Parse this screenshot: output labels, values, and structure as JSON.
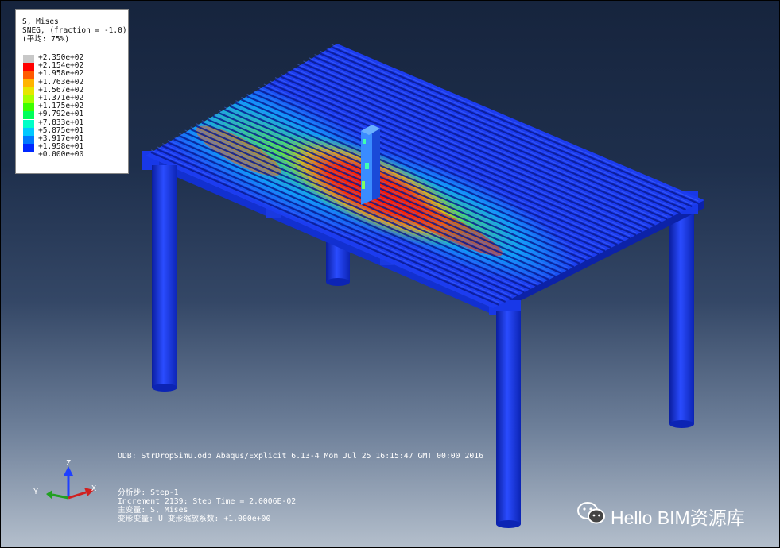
{
  "legend": {
    "title": "S, Mises",
    "subtitle": "SNEG, (fraction = -1.0)",
    "average_label": "(平均: 75%)",
    "colors": [
      "#c8c8c8",
      "#ff0000",
      "#ff5a00",
      "#ffb400",
      "#e6e600",
      "#a6ff00",
      "#3cff00",
      "#00ff5a",
      "#00ffc8",
      "#00c8ff",
      "#0078ff",
      "#0028ff",
      "#0000ff"
    ],
    "values": [
      "+2.350e+02",
      "+2.154e+02",
      "+1.958e+02",
      "+1.763e+02",
      "+1.567e+02",
      "+1.371e+02",
      "+1.175e+02",
      "+9.792e+01",
      "+7.833e+01",
      "+5.875e+01",
      "+3.917e+01",
      "+1.958e+01",
      "+0.000e+00"
    ]
  },
  "info": {
    "odb_line": "ODB: StrDropSimu.odb   Abaqus/Explicit 6.13-4   Mon Jul 25 16:15:47 GMT  00:00 2016",
    "step_line": "分析步: Step-1",
    "increment_line": "Increment     2139: Step Time =    2.0006E-02",
    "primary_var_line": "主变量: S, Mises",
    "deformed_var_line": "变形变量: U   变形缩放系数: +1.000e+00"
  },
  "triad": {
    "x": "X",
    "y": "Y",
    "z": "Z"
  },
  "watermark": {
    "text": "Hello BIM资源库",
    "icon": "wechat-icon"
  },
  "colors": {
    "structure": "#1838e8",
    "background_top": "#16243d",
    "background_bottom": "#b4bfcc"
  }
}
